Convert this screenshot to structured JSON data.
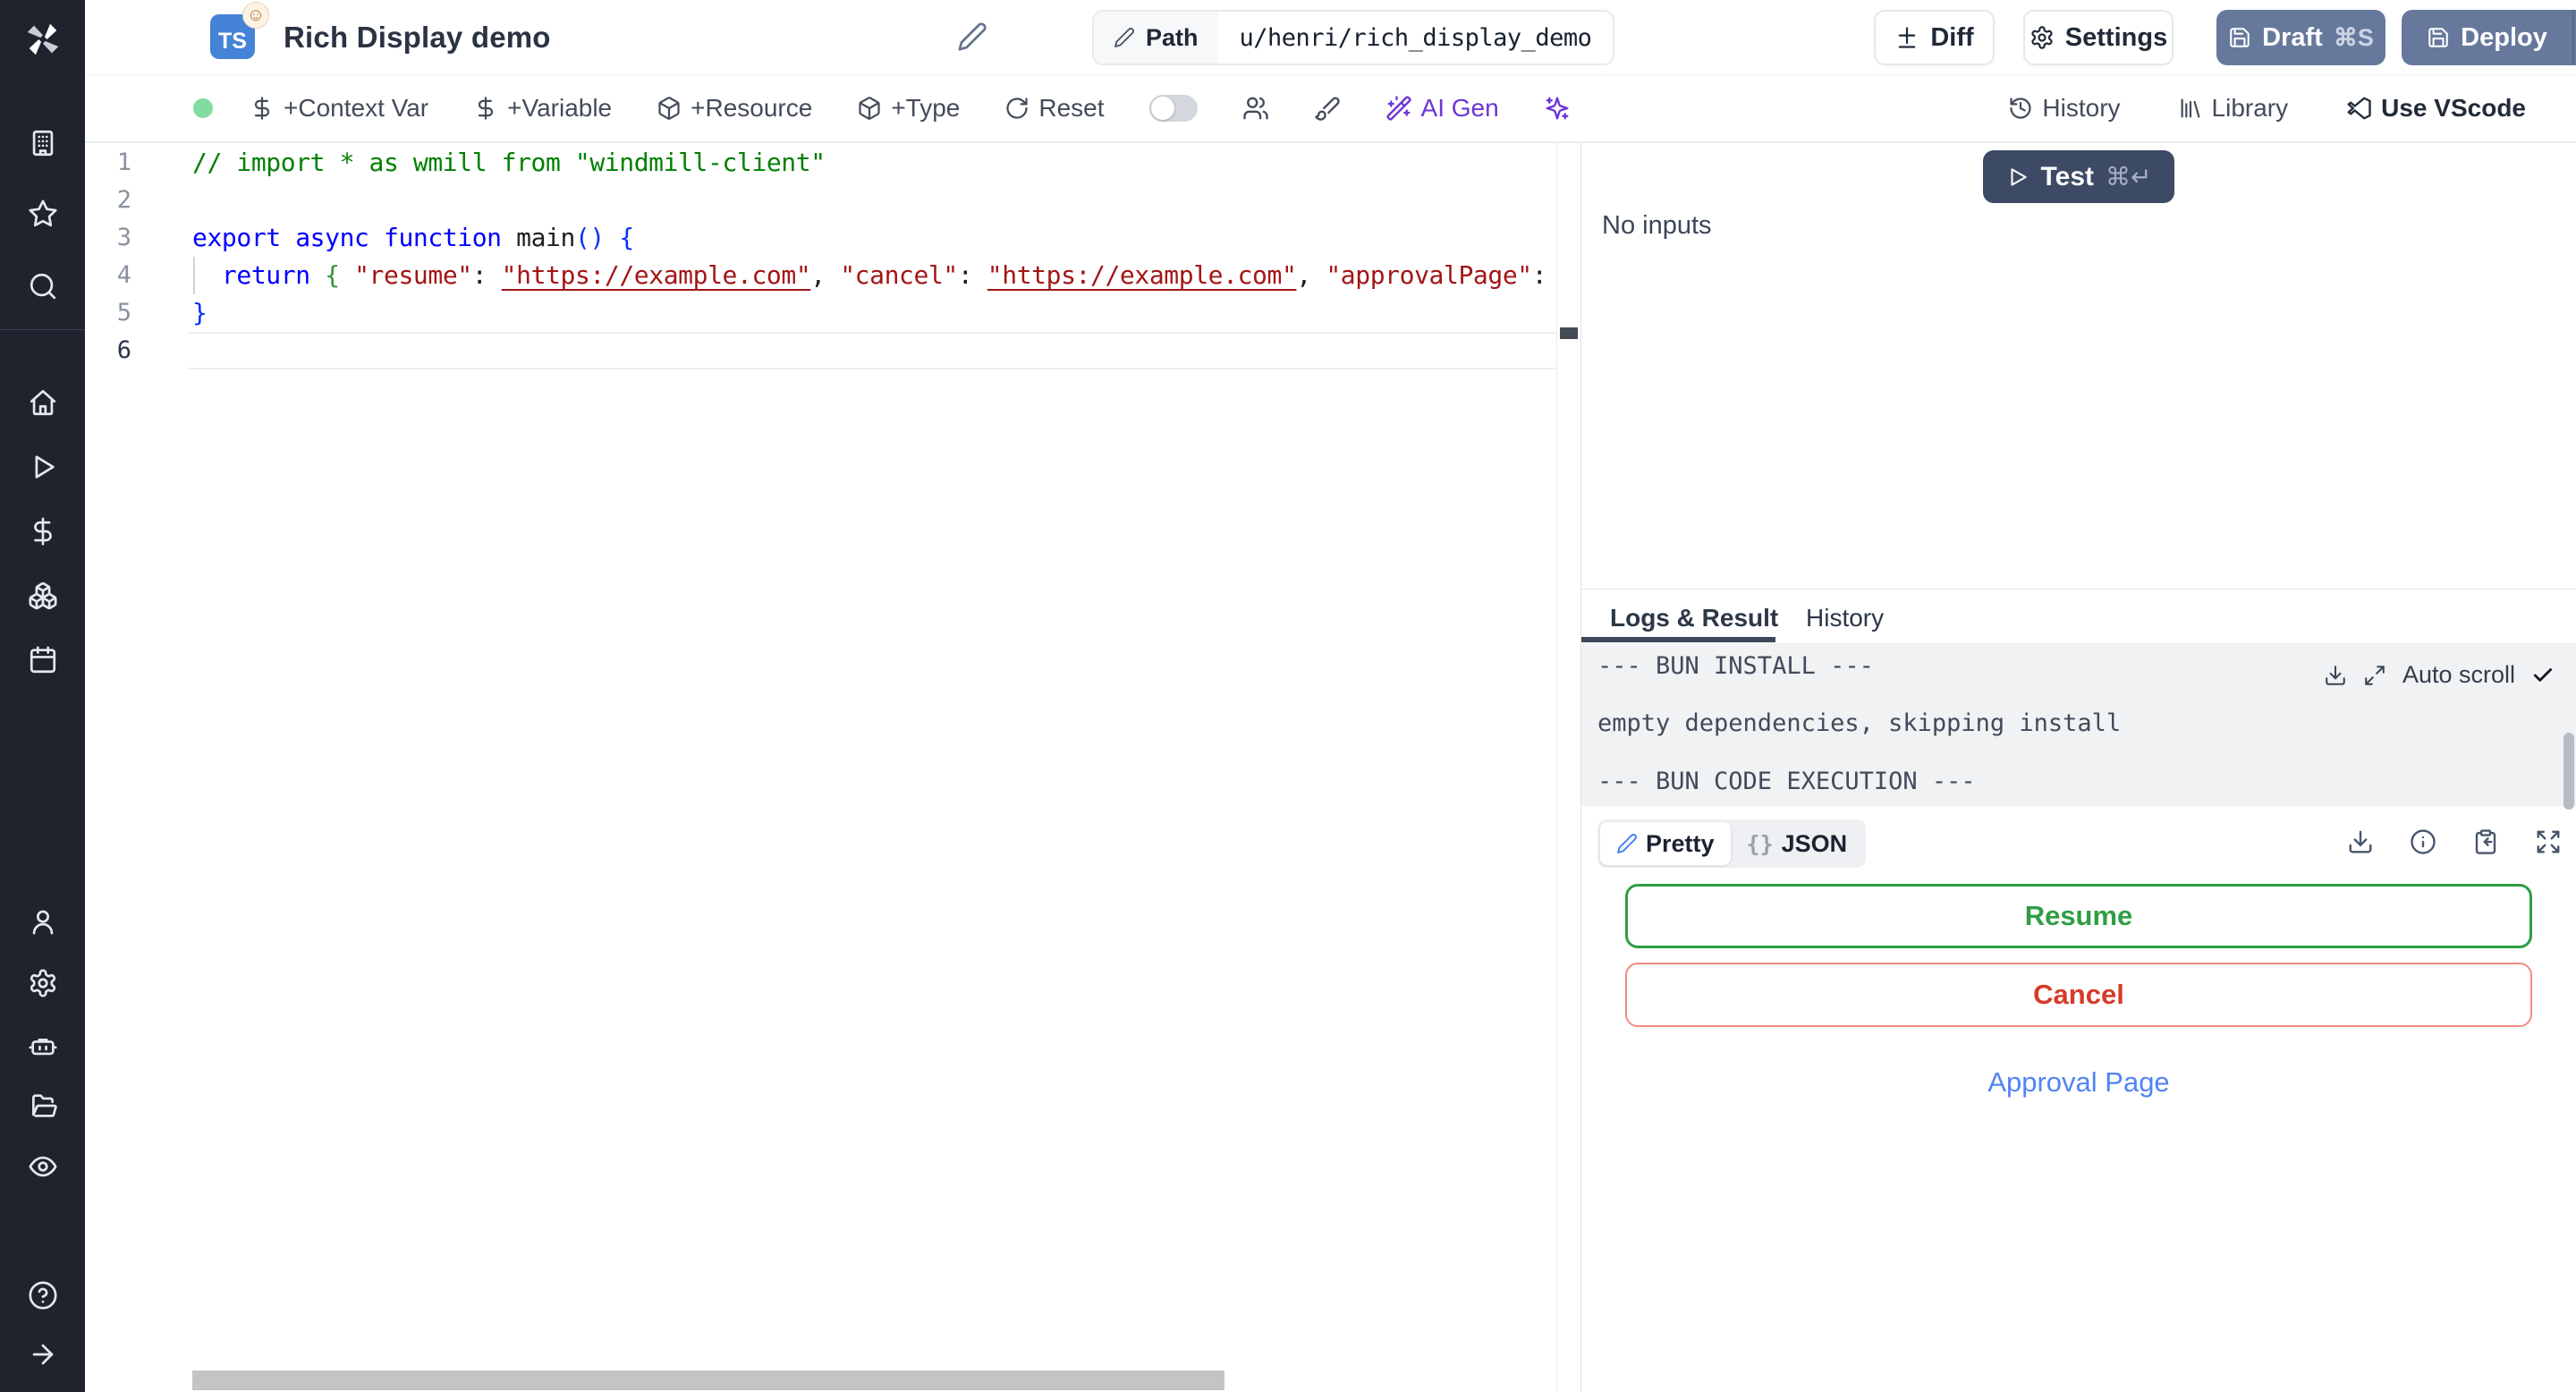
{
  "header": {
    "language_badge": "TS",
    "title": "Rich Display demo",
    "path_label": "Path",
    "path_value": "u/henri/rich_display_demo",
    "diff_label": "Diff",
    "settings_label": "Settings",
    "draft_label": "Draft",
    "draft_shortcut": "⌘S",
    "deploy_label": "Deploy"
  },
  "toolbar": {
    "context_var": "+Context Var",
    "variable": "+Variable",
    "resource": "+Resource",
    "type": "+Type",
    "reset": "Reset",
    "ai_gen": "AI Gen",
    "history": "History",
    "library": "Library",
    "vscode": "Use VScode"
  },
  "sidebar": {
    "icons": [
      "windmill-logo",
      "workspace-building",
      "favorites-star",
      "search",
      "home",
      "runs-play",
      "variables-dollar",
      "resources-boxes",
      "schedules-calendar",
      "users-person",
      "settings-gear",
      "workers-robot",
      "folders",
      "audit-eye",
      "help-circle",
      "collapse-arrow-right"
    ]
  },
  "editor": {
    "line_numbers": [
      "1",
      "2",
      "3",
      "4",
      "5",
      "6"
    ],
    "lines": [
      {
        "tokens": [
          {
            "t": "// import * as wmill from \"windmill-client\""
          }
        ]
      },
      {
        "tokens": []
      },
      {
        "tokens": [
          {
            "t": "export"
          },
          {
            "t": " "
          },
          {
            "t": "async"
          },
          {
            "t": " "
          },
          {
            "t": "function"
          },
          {
            "t": " main"
          },
          {
            "t": "() {"
          }
        ]
      },
      {
        "tokens": [
          {
            "t": "  "
          },
          {
            "t": "return"
          },
          {
            "t": " "
          },
          {
            "t": "{"
          },
          {
            "t": " "
          },
          {
            "t": "\"resume\""
          },
          {
            "t": ": "
          },
          {
            "t": "\"https://example.com\""
          },
          {
            "t": ", "
          },
          {
            "t": "\"cancel\""
          },
          {
            "t": ": "
          },
          {
            "t": "\"https://example.com\""
          },
          {
            "t": ", "
          },
          {
            "t": "\"approvalPage\""
          },
          {
            "t": ":"
          }
        ]
      },
      {
        "tokens": [
          {
            "t": "}"
          }
        ]
      },
      {
        "tokens": []
      }
    ]
  },
  "run_panel": {
    "test_label": "Test",
    "test_shortcut": "⌘↵",
    "no_inputs": "No inputs",
    "tab_logs": "Logs & Result",
    "tab_history": "History",
    "logs": [
      "--- BUN INSTALL ---",
      "empty dependencies, skipping install",
      "--- BUN CODE EXECUTION ---"
    ],
    "auto_scroll": "Auto scroll",
    "result": {
      "pretty": "Pretty",
      "braces": "{}",
      "json": "JSON",
      "resume": "Resume",
      "cancel": "Cancel",
      "approval": "Approval Page"
    }
  },
  "colors": {
    "sidebar_bg": "#1e232e",
    "slate_button": "#66799c",
    "test_button": "#3d4a66",
    "status_green_dot": "#82dba0",
    "ai_purple": "#6c35d6",
    "resume_green": "#2f9e44",
    "cancel_red": "#d63b2a",
    "link_blue": "#5283f4",
    "ts_badge_blue": "#4583d6"
  }
}
